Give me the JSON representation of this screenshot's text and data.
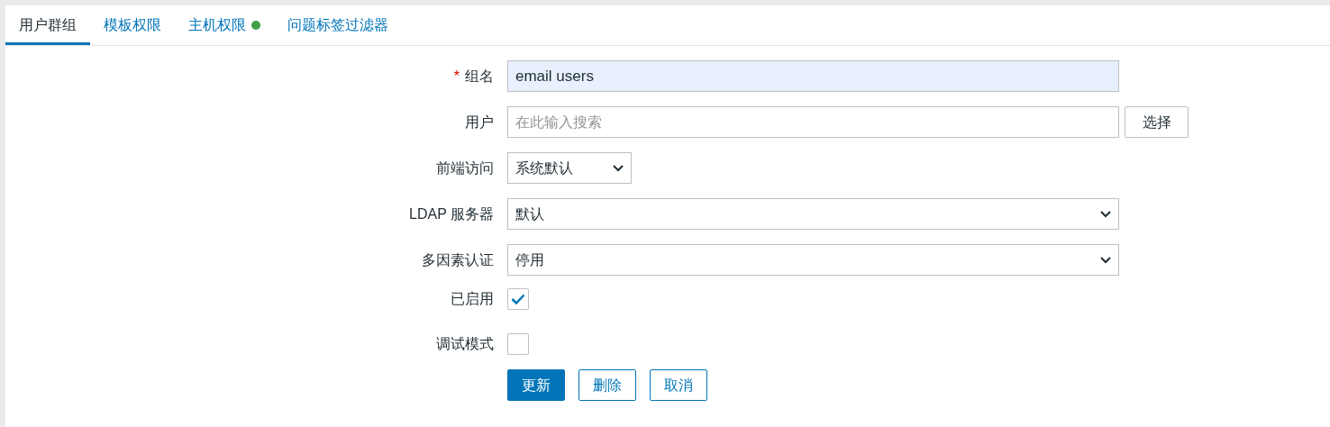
{
  "tabs": [
    {
      "label": "用户群组",
      "selected": true,
      "dot": false
    },
    {
      "label": "模板权限",
      "selected": false,
      "dot": false
    },
    {
      "label": "主机权限",
      "selected": false,
      "dot": true
    },
    {
      "label": "问题标签过滤器",
      "selected": false,
      "dot": false
    }
  ],
  "form": [
    {
      "kind": "text",
      "label": "组名",
      "required_mark": "*",
      "value": "email users"
    },
    {
      "kind": "multiselect",
      "label": "用户",
      "placeholder": "在此输入搜索",
      "button": "选择"
    },
    {
      "kind": "select",
      "label": "前端访问",
      "value": "系统默认",
      "wide": false
    },
    {
      "kind": "select",
      "label": "LDAP 服务器",
      "value": "默认",
      "wide": true
    },
    {
      "kind": "select",
      "label": "多因素认证",
      "value": "停用",
      "wide": true
    },
    {
      "kind": "checkbox",
      "label": "已启用",
      "checked": true
    },
    {
      "kind": "checkbox",
      "label": "调试模式",
      "checked": false
    }
  ],
  "buttons": [
    {
      "label": "更新",
      "primary": true
    },
    {
      "label": "删除",
      "primary": false
    },
    {
      "label": "取消",
      "primary": false
    }
  ]
}
